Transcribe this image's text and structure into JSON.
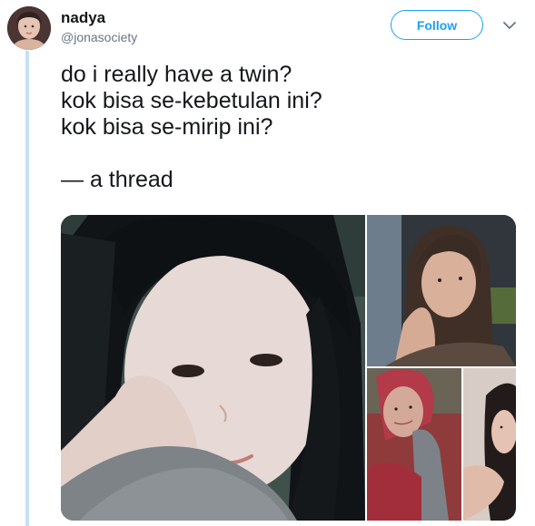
{
  "tweet": {
    "author": {
      "name": "nadya",
      "handle": "@jonasociety"
    },
    "follow_label": "Follow",
    "text": "do i really have a twin?\nkok bisa se-kebetulan ini?\nkok bisa se-mirip ini?\n\n— a thread",
    "media": {
      "count": 4
    }
  },
  "colors": {
    "accent": "#1da1f2",
    "thread_line": "#c4e1f5",
    "text": "#14171a",
    "secondary_text": "#657786"
  },
  "icons": {
    "caret": "chevron-down-icon"
  }
}
